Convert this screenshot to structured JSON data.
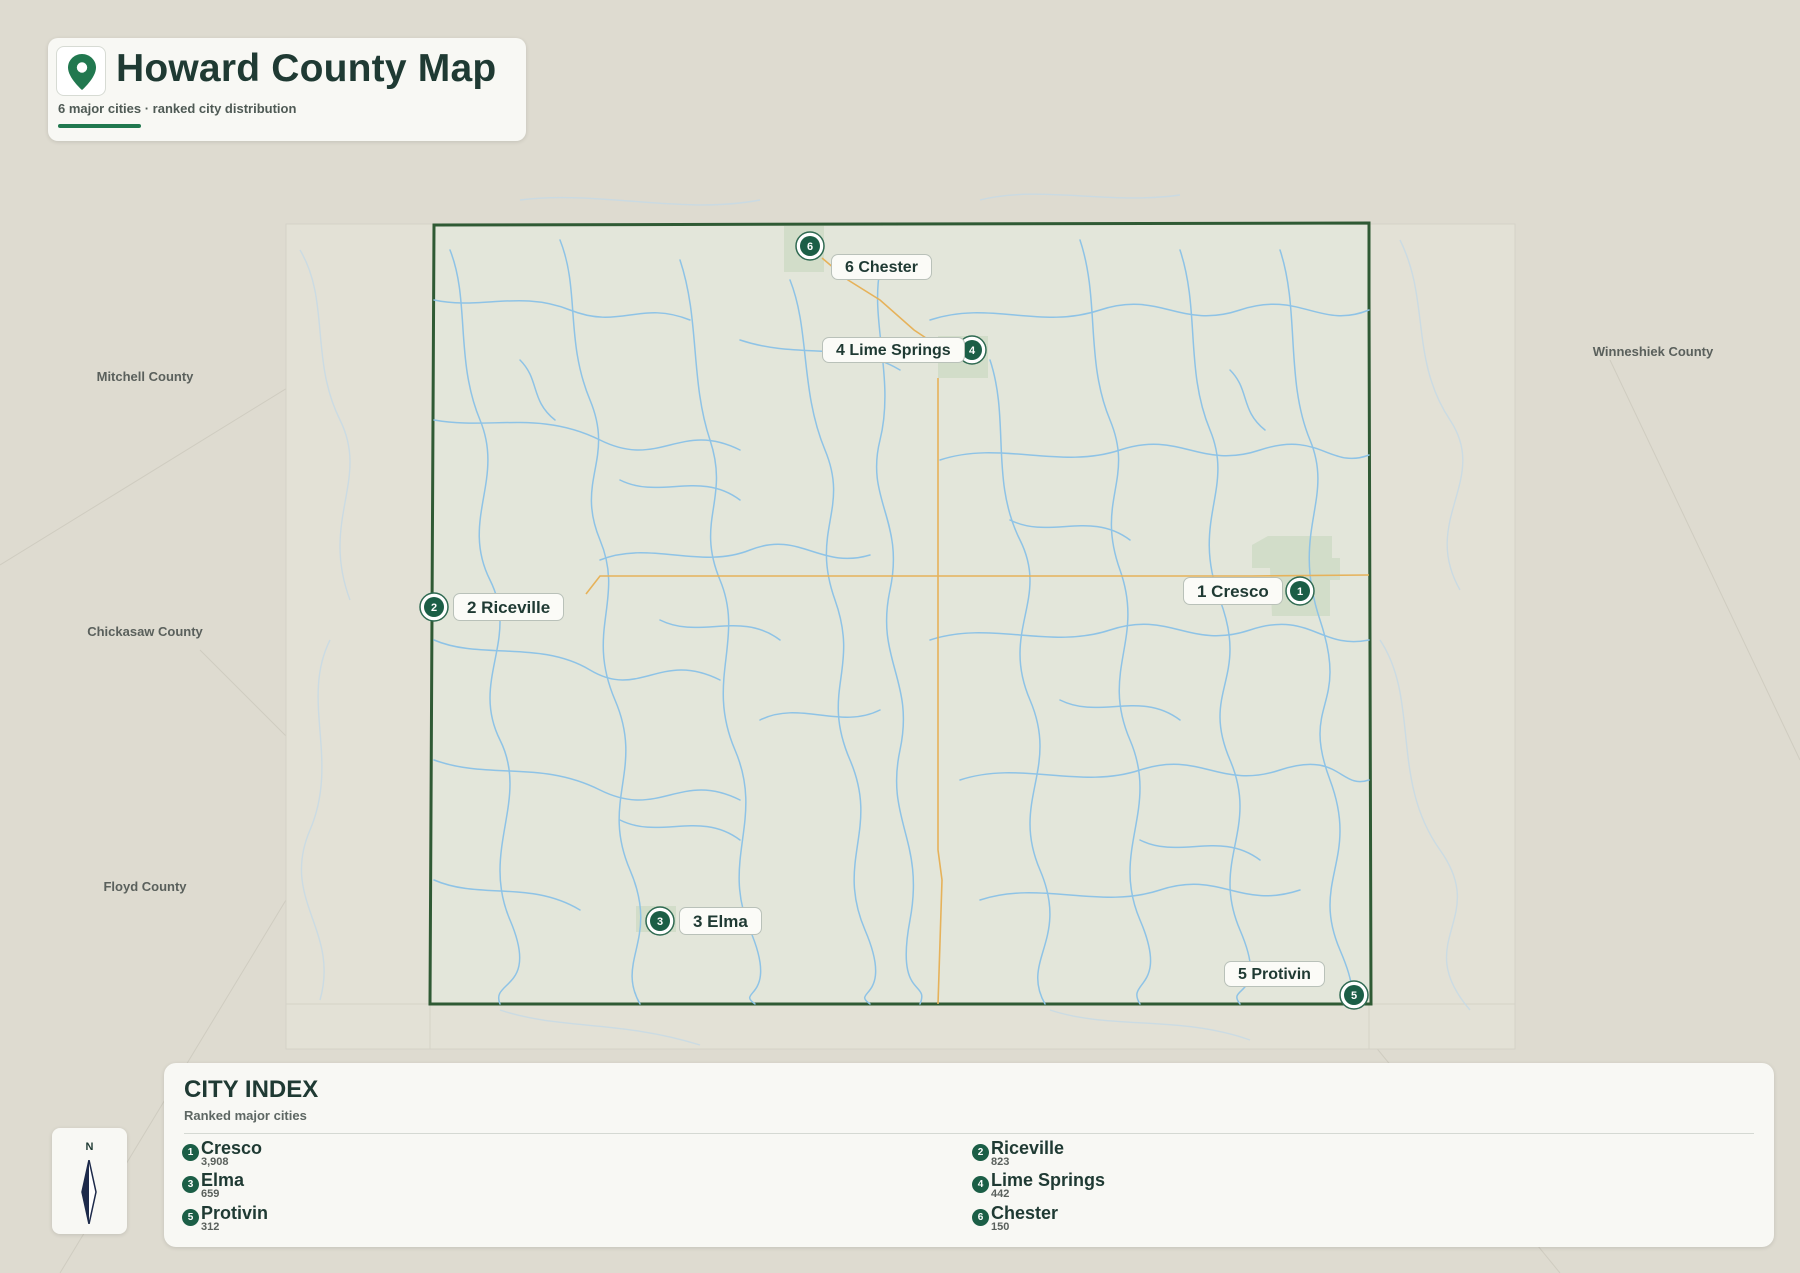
{
  "header": {
    "title": "Howard County Map",
    "subtitle": "6 major cities · ranked city distribution",
    "pin_icon": "map-pin-icon"
  },
  "colors": {
    "accent": "#21784f",
    "badge": "#1b5e46",
    "county_border": "#2f5a34",
    "rivers": "#8ec3e6",
    "roads": "#e6b25a",
    "county_fill": "#e3e6da",
    "background": "#dedbd0",
    "city_area": "#cfdcc6"
  },
  "neighbors": {
    "mitchell": "Mitchell County",
    "chickasaw": "Chickasaw County",
    "floyd": "Floyd County",
    "winneshiek": "Winneshiek County"
  },
  "cities": [
    {
      "rank": "1",
      "name": "Cresco",
      "population": "3,908",
      "label": "1 Cresco"
    },
    {
      "rank": "2",
      "name": "Riceville",
      "population": "823",
      "label": "2 Riceville"
    },
    {
      "rank": "3",
      "name": "Elma",
      "population": "659",
      "label": "3 Elma"
    },
    {
      "rank": "4",
      "name": "Lime Springs",
      "population": "442",
      "label": "4 Lime Springs"
    },
    {
      "rank": "5",
      "name": "Protivin",
      "population": "312",
      "label": "5 Protivin"
    },
    {
      "rank": "6",
      "name": "Chester",
      "population": "150",
      "label": "6 Chester"
    }
  ],
  "index": {
    "title": "CITY INDEX",
    "subtitle": "Ranked major cities"
  },
  "compass": {
    "north_label": "N",
    "icon": "north-arrow-icon"
  }
}
